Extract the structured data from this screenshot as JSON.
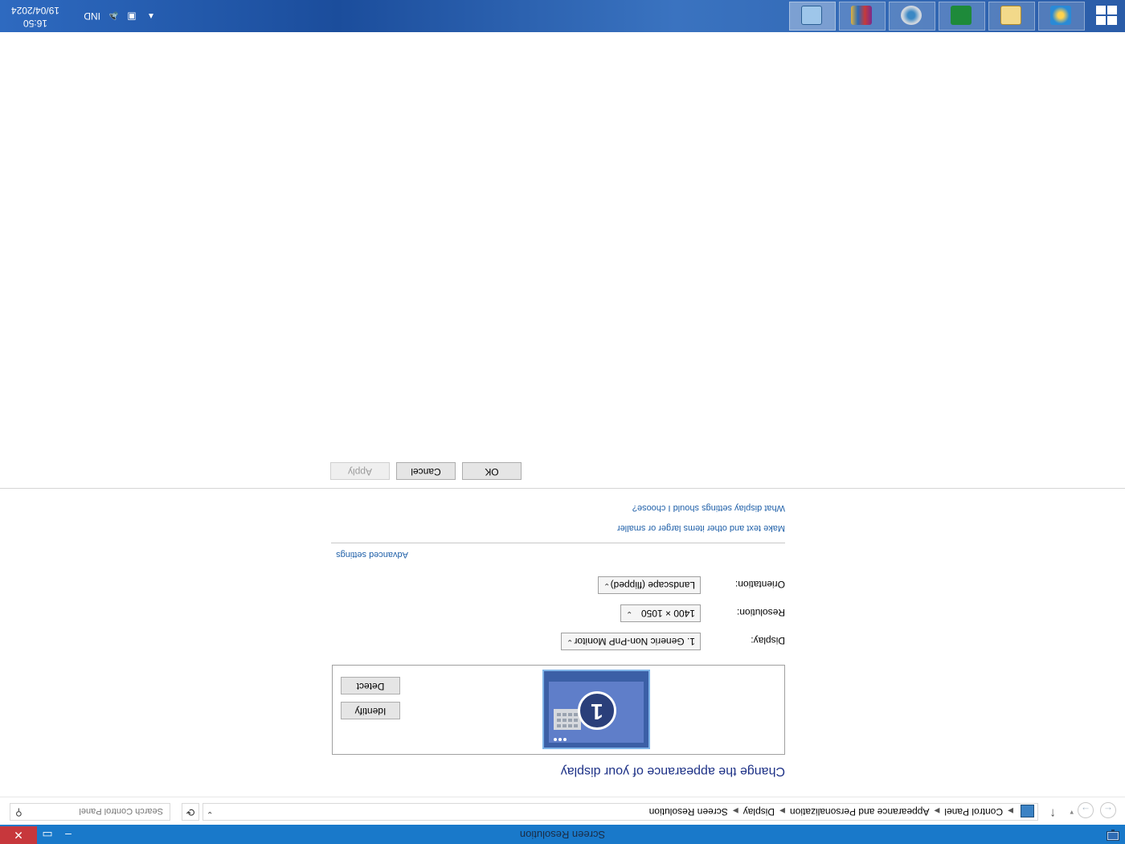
{
  "window": {
    "title": "Screen Resolution",
    "minimize_glyph": "–",
    "maximize_glyph": "▭",
    "close_glyph": "✕"
  },
  "address_bar": {
    "breadcrumbs": [
      "Control Panel",
      "Appearance and Personalization",
      "Display",
      "Screen Resolution"
    ],
    "search_placeholder": "Search Control Panel"
  },
  "content": {
    "heading": "Change the appearance of your display",
    "monitor_number": "1",
    "detect_label": "Detect",
    "identify_label": "Identify",
    "display_label": "Display:",
    "display_value": "1. Generic Non-PnP Monitor",
    "resolution_label": "Resolution:",
    "resolution_value": "1400 × 1050",
    "orientation_label": "Orientation:",
    "orientation_value": "Landscape (flipped)",
    "advanced_link": "Advanced settings",
    "text_size_link": "Make text and other items larger or smaller",
    "help_link": "What display settings should I choose?",
    "ok_label": "OK",
    "cancel_label": "Cancel",
    "apply_label": "Apply"
  },
  "taskbar": {
    "apps": [
      "control-panel",
      "winrar",
      "disk-utility",
      "spreadsheet",
      "file-explorer",
      "internet-explorer"
    ],
    "language": "IND",
    "time": "16:50",
    "date": "19/04/2024"
  },
  "colors": {
    "titlebar": "#1979ca",
    "close_button": "#c7373c",
    "heading": "#1e3287",
    "link": "#1e5fa8"
  }
}
